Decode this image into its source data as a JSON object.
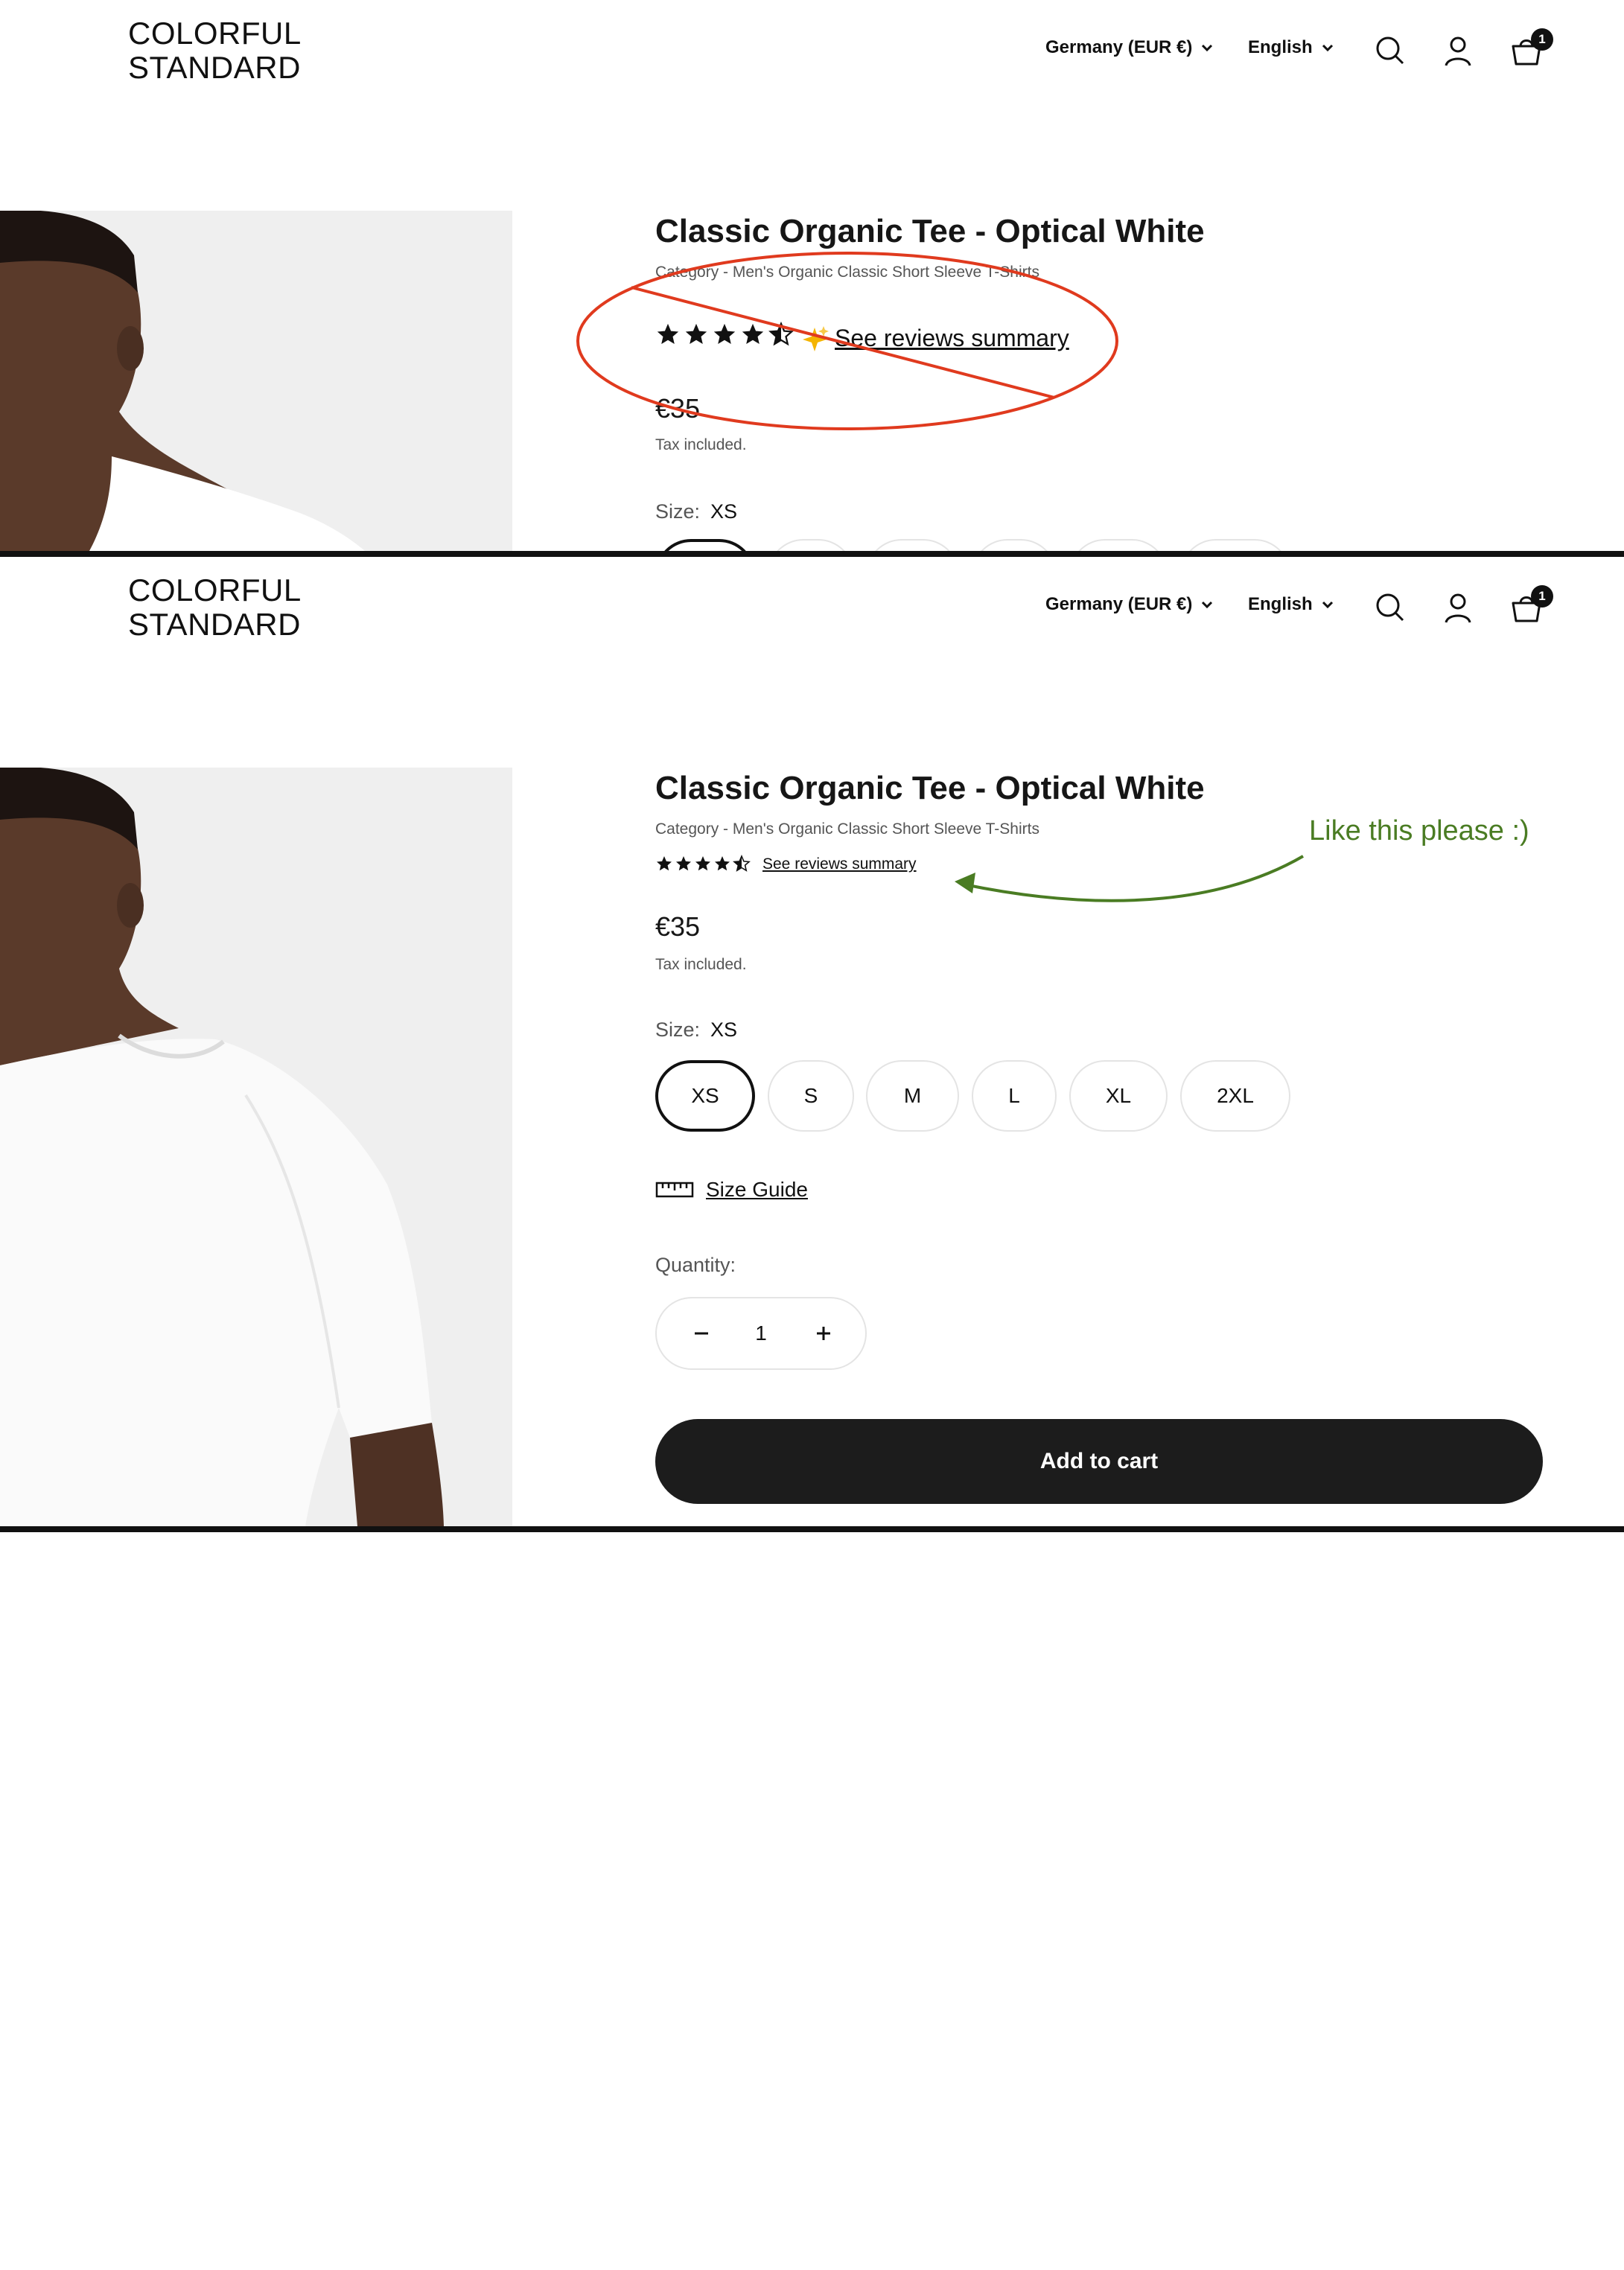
{
  "header": {
    "logo_line1": "COLORFUL",
    "logo_line2": "STANDARD",
    "country": "Germany (EUR €)",
    "language": "English",
    "cart_count": "1"
  },
  "product": {
    "title": "Classic Organic Tee - Optical White",
    "category": "Category - Men's Organic Classic Short Sleeve T-Shirts",
    "rating": 4.5,
    "reviews_link": "See reviews summary",
    "price": "€35",
    "tax_note": "Tax included.",
    "size_label": "Size:",
    "selected_size": "XS",
    "sizes": [
      "XS",
      "S",
      "M",
      "L",
      "XL",
      "2XL"
    ],
    "size_guide": "Size Guide",
    "quantity_label": "Quantity:",
    "quantity": "1",
    "add_to_cart": "Add to cart"
  },
  "annotations": {
    "rejected_mark": "red-ellipse-with-strike",
    "approved_note": "Like this please :)",
    "colors": {
      "red": "#e03a1e",
      "green": "#4a7c23"
    }
  },
  "icons": [
    "chevron-down-icon",
    "search-icon",
    "account-icon",
    "cart-icon",
    "star-icon",
    "sparkle-icon",
    "ruler-icon",
    "minus-icon",
    "plus-icon"
  ]
}
